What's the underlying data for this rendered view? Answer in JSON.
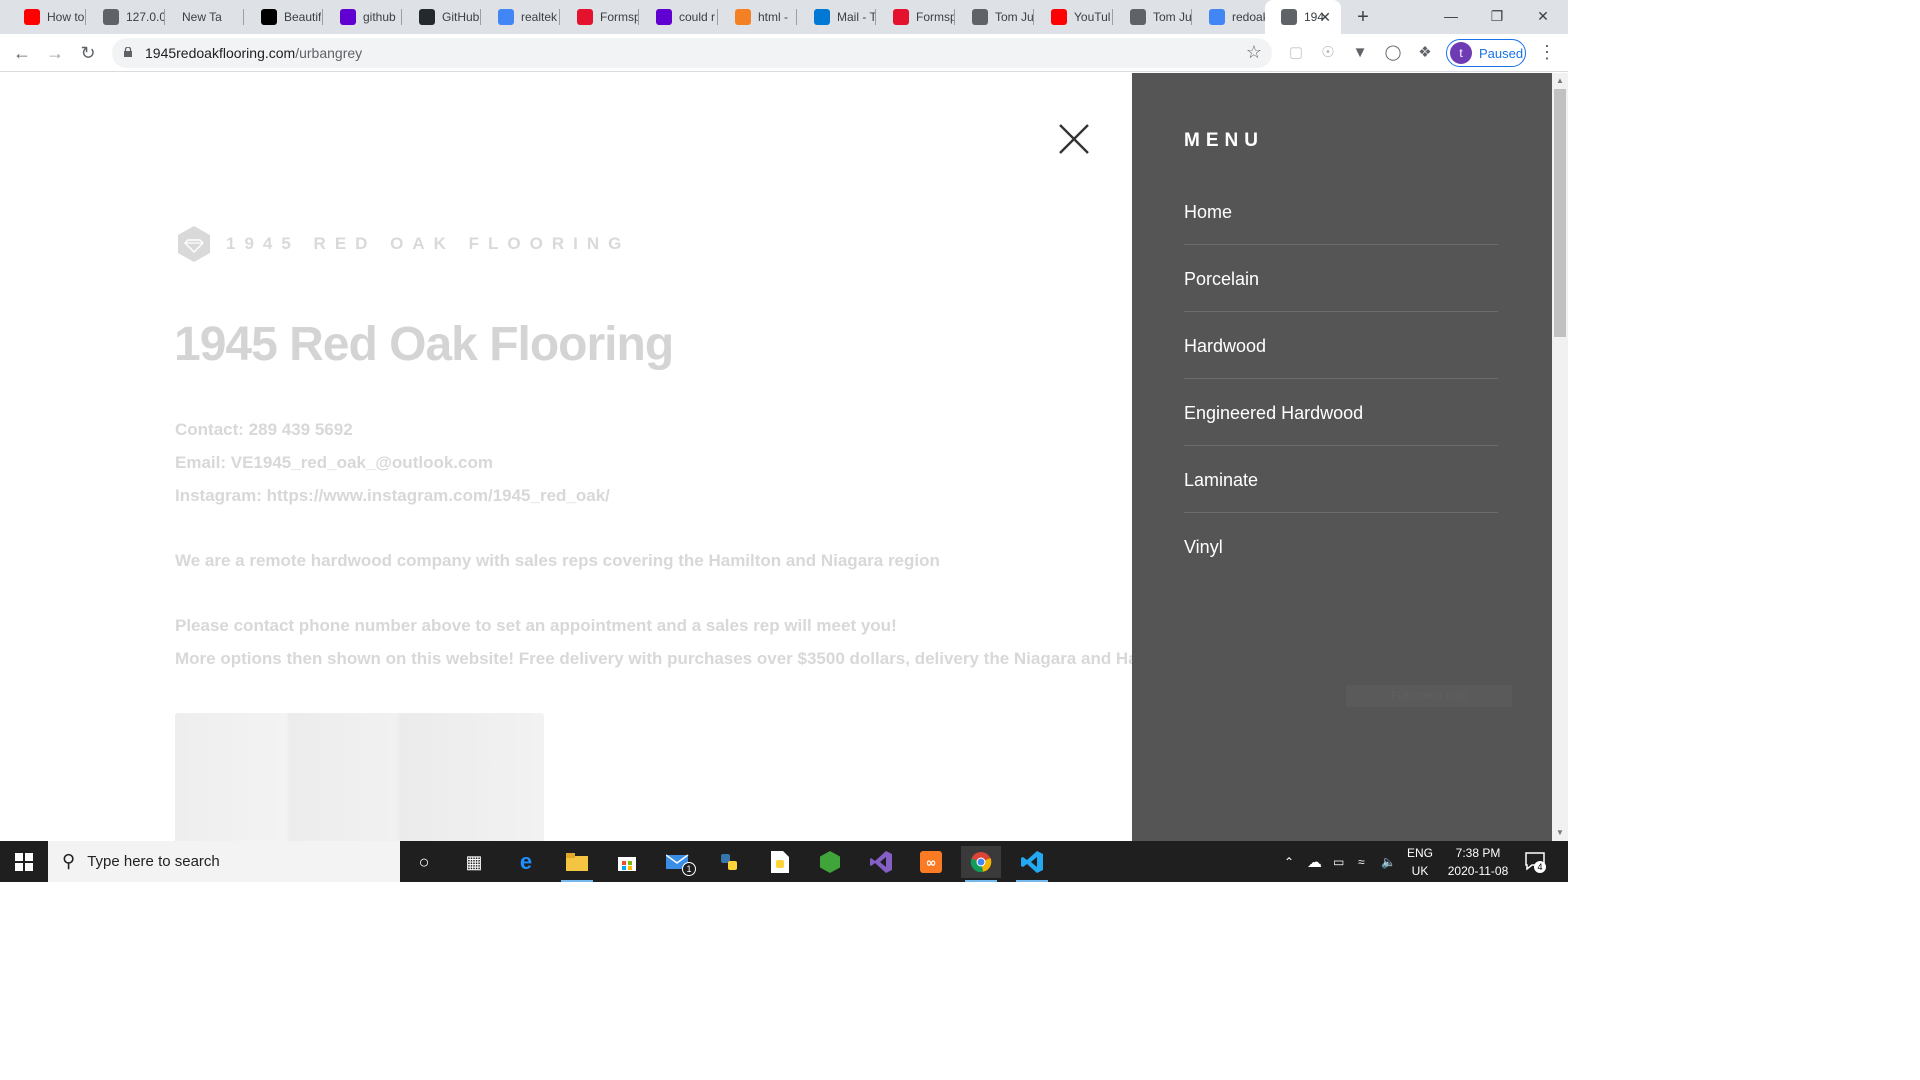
{
  "browser": {
    "tabs": [
      {
        "label": "How to",
        "icon": "youtube-icon",
        "color": "#ff0000"
      },
      {
        "label": "127.0.0",
        "icon": "globe-icon",
        "color": "#5f6368"
      },
      {
        "label": "New Tab",
        "icon": "",
        "color": ""
      },
      {
        "label": "Beautif",
        "icon": "app-icon",
        "color": "#000000"
      },
      {
        "label": "github",
        "icon": "yahoo-icon",
        "color": "#6001d2"
      },
      {
        "label": "GitHub",
        "icon": "github-icon",
        "color": "#24292e"
      },
      {
        "label": "realtek",
        "icon": "google-icon",
        "color": "#4285f4"
      },
      {
        "label": "Formsp",
        "icon": "formspree-icon",
        "color": "#e5122e"
      },
      {
        "label": "could r",
        "icon": "yahoo-icon",
        "color": "#6001d2"
      },
      {
        "label": "html -",
        "icon": "stackoverflow-icon",
        "color": "#f48024"
      },
      {
        "label": "Mail - T",
        "icon": "outlook-icon",
        "color": "#0078d4"
      },
      {
        "label": "Formsp",
        "icon": "formspree-icon",
        "color": "#e5122e"
      },
      {
        "label": "Tom Ju",
        "icon": "globe-icon",
        "color": "#5f6368"
      },
      {
        "label": "YouTul",
        "icon": "youtube-icon",
        "color": "#ff0000"
      },
      {
        "label": "Tom Ju",
        "icon": "globe-icon",
        "color": "#5f6368"
      },
      {
        "label": "redoak",
        "icon": "google-icon",
        "color": "#4285f4"
      },
      {
        "label": "194",
        "icon": "globe-icon",
        "color": "#5f6368",
        "active": true
      }
    ],
    "url_host": "1945redoakflooring.com",
    "url_path": "/urbangrey",
    "profile_initial": "t",
    "profile_status": "Paused"
  },
  "site": {
    "brand_name": "1945 RED OAK FLOORING",
    "title": "1945 Red Oak Flooring",
    "contact": "Contact: 289 439 5692",
    "email": "Email: VE1945_red_oak_@outlook.com",
    "instagram": "Instagram: https://www.instagram.com/1945_red_oak/",
    "about": "We are a remote hardwood company with sales reps covering the Hamilton and Niagara region",
    "appointment": "Please contact phone number above to set an appointment and a sales rep will meet you!",
    "options": "More options then shown on this website! Free delivery with purchases over $3500 dollars, delivery the Niagara and Hamilton region",
    "menu_heading": "MENU",
    "menu_items": [
      "Home",
      "Porcelain",
      "Hardwood",
      "Engineered Hardwood",
      "Laminate",
      "Vinyl"
    ],
    "faint_badge": "Fullscreen Salo",
    "colors": {
      "menu_bg": "#555555",
      "faded_text": "#d8d8d8"
    }
  },
  "taskbar": {
    "search_placeholder": "Type here to search",
    "language": "ENG",
    "region": "UK",
    "time": "7:38 PM",
    "date": "2020-11-08",
    "mail_badge": "1",
    "notification_count": "4"
  }
}
